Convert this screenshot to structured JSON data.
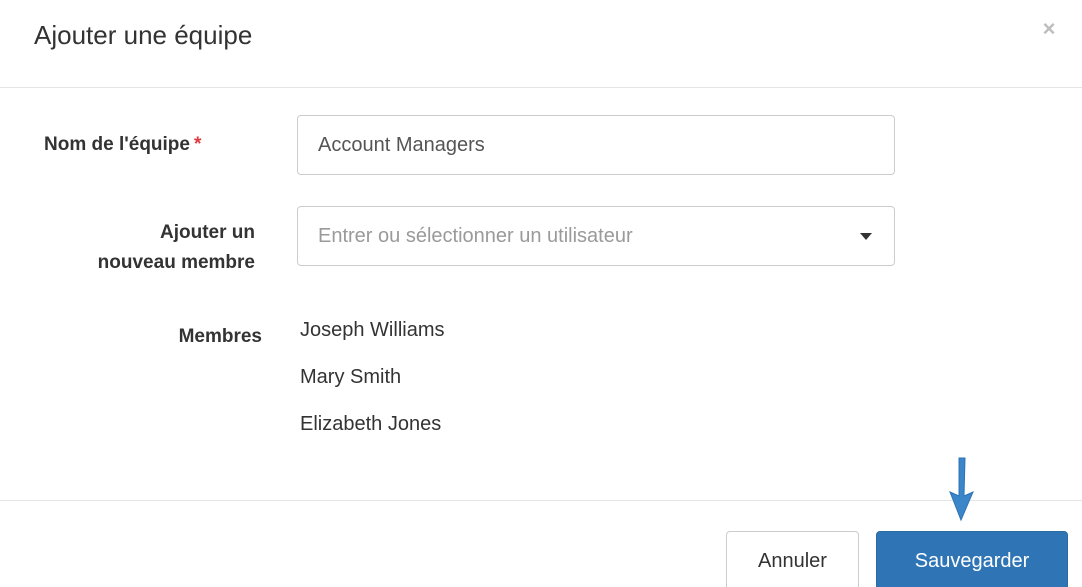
{
  "dialog": {
    "title": "Ajouter une équipe",
    "close_symbol": "×"
  },
  "form": {
    "team_name": {
      "label": "Nom de l'équipe",
      "required_mark": "*",
      "value": "Account Managers"
    },
    "add_member": {
      "label_line1": "Ajouter un",
      "label_line2": "nouveau membre",
      "placeholder": "Entrer ou sélectionner un utilisateur"
    },
    "members": {
      "label": "Membres",
      "items": [
        "Joseph Williams",
        "Mary Smith",
        "Elizabeth Jones"
      ]
    }
  },
  "footer": {
    "cancel_label": "Annuler",
    "save_label": "Sauvegarder"
  },
  "colors": {
    "primary": "#2f74b5",
    "required": "#e0393e",
    "annotation_arrow": "#3a86c8"
  },
  "icons": {
    "close": "close-icon",
    "dropdown": "caret-down-icon",
    "annotation": "down-arrow-annotation-icon"
  }
}
